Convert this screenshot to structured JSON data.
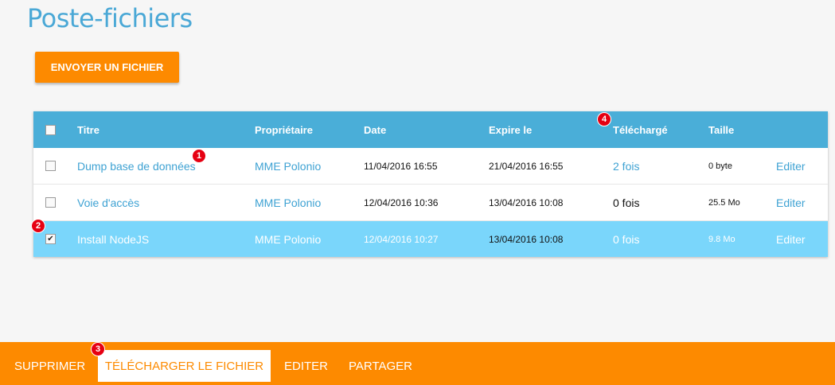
{
  "page": {
    "title": "Poste-fichiers"
  },
  "actions": {
    "upload_label": "ENVOYER UN FICHIER"
  },
  "table": {
    "headers": {
      "title": "Titre",
      "owner": "Propriétaire",
      "date": "Date",
      "expires": "Expire le",
      "downloaded": "Téléchargé",
      "size": "Taille"
    },
    "rows": [
      {
        "title": "Dump base de données",
        "owner": "MME Polonio",
        "date": "11/04/2016 16:55",
        "expires": "21/04/2016 16:55",
        "downloaded": "2 fois",
        "size": "0 byte",
        "edit": "Editer",
        "checked": false
      },
      {
        "title": "Voie d'accès",
        "owner": "MME Polonio",
        "date": "12/04/2016 10:36",
        "expires": "13/04/2016 10:08",
        "downloaded": "0 fois",
        "size": "25.5 Mo",
        "edit": "Editer",
        "checked": false
      },
      {
        "title": "Install NodeJS",
        "owner": "MME Polonio",
        "date": "12/04/2016 10:27",
        "expires": "13/04/2016 10:08",
        "downloaded": "0 fois",
        "size": "9.8 Mo",
        "edit": "Editer",
        "checked": true
      }
    ]
  },
  "bottom_bar": {
    "delete": "SUPPRIMER",
    "download": "TÉLÉCHARGER LE FICHIER",
    "edit": "EDITER",
    "share": "PARTAGER"
  },
  "badges": {
    "b1": "1",
    "b2": "2",
    "b3": "3",
    "b4": "4"
  },
  "colors": {
    "accent_orange": "#fd8a00",
    "header_blue": "#4aaed8",
    "title_blue": "#4aa8d6",
    "selected_row": "#7ad6fb",
    "badge_red": "#e60012"
  },
  "icons": {
    "checkbox_checked": "✔"
  }
}
